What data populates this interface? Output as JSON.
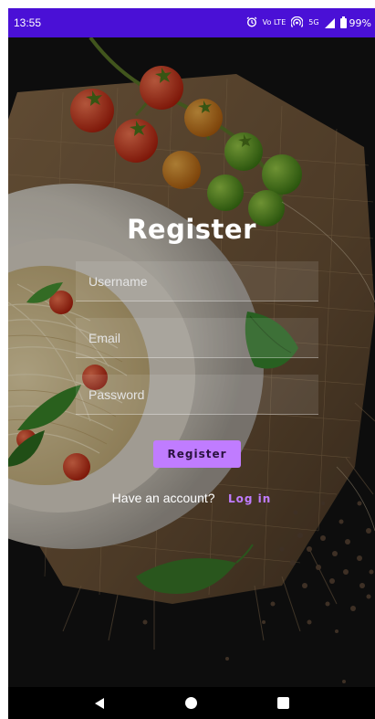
{
  "status_bar": {
    "time": "13:55",
    "icons": [
      "alarm-icon",
      "volte-icon",
      "hotspot-icon",
      "5g-icon",
      "signal-icon",
      "battery-icon"
    ],
    "volte_text": "Vo LTE",
    "network_text": "5G",
    "battery_text": "99%"
  },
  "form": {
    "title": "Register",
    "username_placeholder": "Username",
    "email_placeholder": "Email",
    "password_placeholder": "Password",
    "register_label": "Register",
    "have_account_text": "Have an account?",
    "login_label": "Log in"
  },
  "navigation": {
    "icons": [
      "back-icon",
      "home-icon",
      "recents-icon"
    ]
  },
  "colors": {
    "status_bar": "#4a10d6",
    "accent": "#c07cff",
    "background": "#141414"
  }
}
